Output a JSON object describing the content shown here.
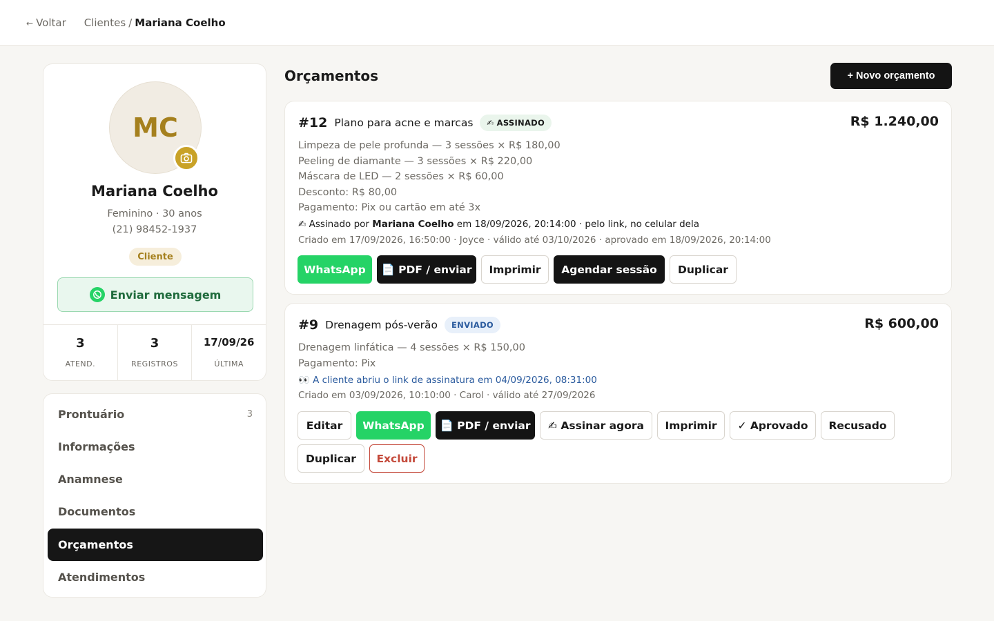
{
  "topbar": {
    "back_arrow": "←",
    "back_label": "Voltar",
    "crumb_parent": "Clientes",
    "crumb_sep": "/",
    "crumb_current": "Mariana Coelho"
  },
  "profile": {
    "initials": "MC",
    "camera_icon": "camera-icon",
    "name": "Mariana Coelho",
    "info_line1": "Feminino · 30 anos",
    "phone": "(21) 98452-1937",
    "badge": "Cliente",
    "send_message_label": "Enviar mensagem",
    "stats": [
      {
        "value": "3",
        "label": "ATEND."
      },
      {
        "value": "3",
        "label": "REGISTROS"
      },
      {
        "value": "17/09/26",
        "label": "ÚLTIMA"
      }
    ]
  },
  "menu": {
    "items": [
      {
        "label": "Prontuário",
        "count": "3"
      },
      {
        "label": "Informações"
      },
      {
        "label": "Anamnese"
      },
      {
        "label": "Documentos"
      },
      {
        "label": "Orçamentos",
        "active": true
      },
      {
        "label": "Atendimentos"
      }
    ]
  },
  "main": {
    "title": "Orçamentos",
    "new_button": "+ Novo orçamento",
    "quotes": [
      {
        "number": "#12",
        "title": "Plano para acne e marcas",
        "status": "✍ ASSINADO",
        "price": "R$ 1.240,00",
        "lines": [
          "Limpeza de pele profunda — 3 sessões × R$ 180,00",
          "Peeling de diamante — 3 sessões × R$ 220,00",
          "Máscara de LED — 2 sessões × R$ 60,00",
          "Desconto: R$ 80,00",
          "Pagamento: Pix ou cartão em até 3x"
        ],
        "signed_prefix": "✍ Assinado por ",
        "signed_name": "Mariana Coelho",
        "signed_suffix": " em 18/09/2026, 20:14:00 · pelo link, no celular dela",
        "meta": "Criado em 17/09/2026, 16:50:00 · Joyce · válido até 03/10/2026 · aprovado em 18/09/2026, 20:14:00",
        "buttons": [
          "WhatsApp",
          "📄 PDF / enviar",
          "Imprimir",
          "Agendar sessão",
          "Duplicar"
        ]
      },
      {
        "number": "#9",
        "title": "Drenagem pós-verão",
        "status": "ENVIADO",
        "price": "R$ 600,00",
        "lines": [
          "Drenagem linfática — 4 sessões × R$ 150,00",
          "Pagamento: Pix"
        ],
        "opened_note": "👀 A cliente abriu o link de assinatura em 04/09/2026, 08:31:00",
        "meta": "Criado em 03/09/2026, 10:10:00 · Carol · válido até 27/09/2026",
        "buttons": [
          "Editar",
          "WhatsApp",
          "📄 PDF / enviar",
          "✍ Assinar agora",
          "Imprimir",
          "✓ Aprovado",
          "Recusado",
          "Duplicar",
          "Excluir"
        ]
      }
    ]
  },
  "colors": {
    "accent_gold": "#c9a227",
    "whatsapp_green": "#25d366",
    "dark": "#141414",
    "danger": "#c4493a",
    "sent_blue": "#2b5b9e"
  }
}
